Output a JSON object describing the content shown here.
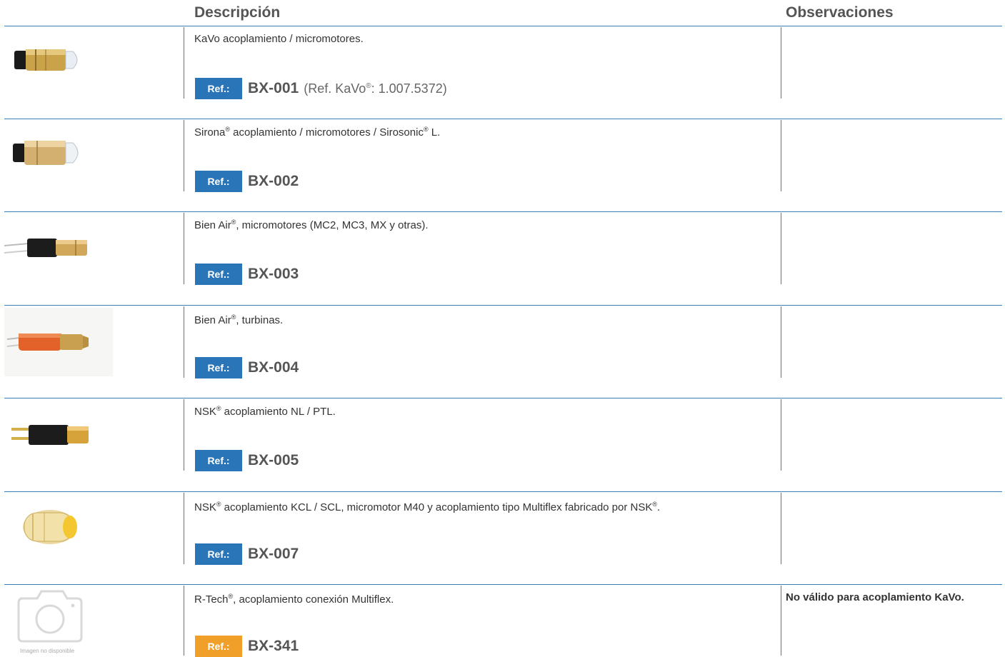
{
  "header": {
    "description": "Descripción",
    "observations": "Observaciones"
  },
  "rows": [
    {
      "image": "kavo-coupling-image",
      "desc_pre": "KaVo acoplamiento / micromotores.",
      "ref_label": "Ref.:",
      "ref_code": "BX-001",
      "ref_extra_pre": "(Ref. KaVo",
      "ref_extra_reg": "®",
      "ref_extra_post": ": 1.007.5372)",
      "observation": ""
    },
    {
      "image": "sirona-coupling-image",
      "desc_pre": "Sirona",
      "desc_reg1": "®",
      "desc_mid": " acoplamiento / micromotores / Sirosonic",
      "desc_reg2": "®",
      "desc_post": " L.",
      "ref_label": "Ref.:",
      "ref_code": "BX-002",
      "observation": ""
    },
    {
      "image": "bienair-micromotor-image",
      "desc_pre": "Bien Air",
      "desc_reg1": "®",
      "desc_mid": ", micromotores (MC2, MC3, MX y otras).",
      "ref_label": "Ref.:",
      "ref_code": "BX-003",
      "observation": ""
    },
    {
      "image": "bienair-turbine-image",
      "desc_pre": "Bien Air",
      "desc_reg1": "®",
      "desc_mid": ", turbinas.",
      "ref_label": "Ref.:",
      "ref_code": "BX-004",
      "observation": ""
    },
    {
      "image": "nsk-nl-coupling-image",
      "desc_pre": "NSK",
      "desc_reg1": "®",
      "desc_mid": " acoplamiento NL / PTL.",
      "ref_label": "Ref.:",
      "ref_code": "BX-005",
      "observation": ""
    },
    {
      "image": "nsk-kcl-coupling-image",
      "desc_pre": "NSK",
      "desc_reg1": "®",
      "desc_mid": " acoplamiento KCL / SCL, micromotor M40 y acoplamiento tipo Multiflex fabricado por NSK",
      "desc_reg2": "®",
      "desc_post": ".",
      "ref_label": "Ref.:",
      "ref_code": "BX-007",
      "observation": ""
    },
    {
      "image": "camera-icon",
      "image_caption": "Imagen no disponible",
      "desc_pre": "R-Tech",
      "desc_reg1": "®",
      "desc_mid": ", acoplamiento conexión Multiflex.",
      "ref_label": "Ref.:",
      "ref_code": "BX-341",
      "observation": "No válido para acoplamiento KaVo."
    }
  ],
  "colors": {
    "line": "#3b7fb8",
    "badge_blue": "#2a74b8",
    "badge_orange": "#f0a028"
  }
}
